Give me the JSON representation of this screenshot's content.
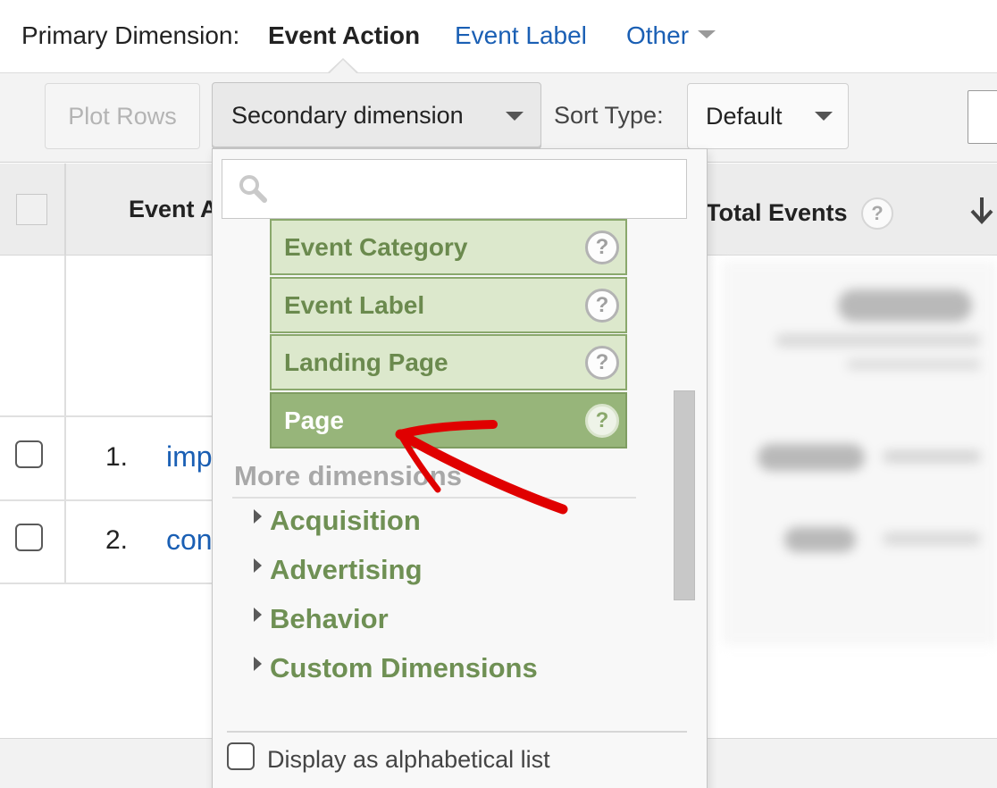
{
  "primary_dimension": {
    "label": "Primary Dimension:",
    "active": "Event Action",
    "options": [
      "Event Label",
      "Other"
    ]
  },
  "toolbar": {
    "plot_rows": "Plot Rows",
    "secondary_dimension": "Secondary dimension",
    "sort_type_label": "Sort Type:",
    "sort_type_value": "Default"
  },
  "table": {
    "header_event_action": "Event A",
    "header_total_events": "Total Events",
    "rows": [
      {
        "num": "1.",
        "link": "imp"
      },
      {
        "num": "2.",
        "link": "con"
      }
    ]
  },
  "dropdown": {
    "search_placeholder": "",
    "items": [
      {
        "label": "Event Category",
        "selected": false
      },
      {
        "label": "Event Label",
        "selected": false
      },
      {
        "label": "Landing Page",
        "selected": false
      },
      {
        "label": "Page",
        "selected": true
      }
    ],
    "more_header": "More dimensions",
    "categories": [
      "Acquisition",
      "Advertising",
      "Behavior",
      "Custom Dimensions"
    ],
    "alphabetical_label": "Display as alphabetical list"
  },
  "icons": {
    "help": "?",
    "search": "search-icon",
    "sort": "arrow-down-icon"
  },
  "colors": {
    "accent_link": "#1a5fb4",
    "dim_item_bg": "#dce8cc",
    "dim_item_selected_bg": "#97b57a",
    "dim_text": "#6f9054",
    "annotation_arrow": "#e00000"
  }
}
